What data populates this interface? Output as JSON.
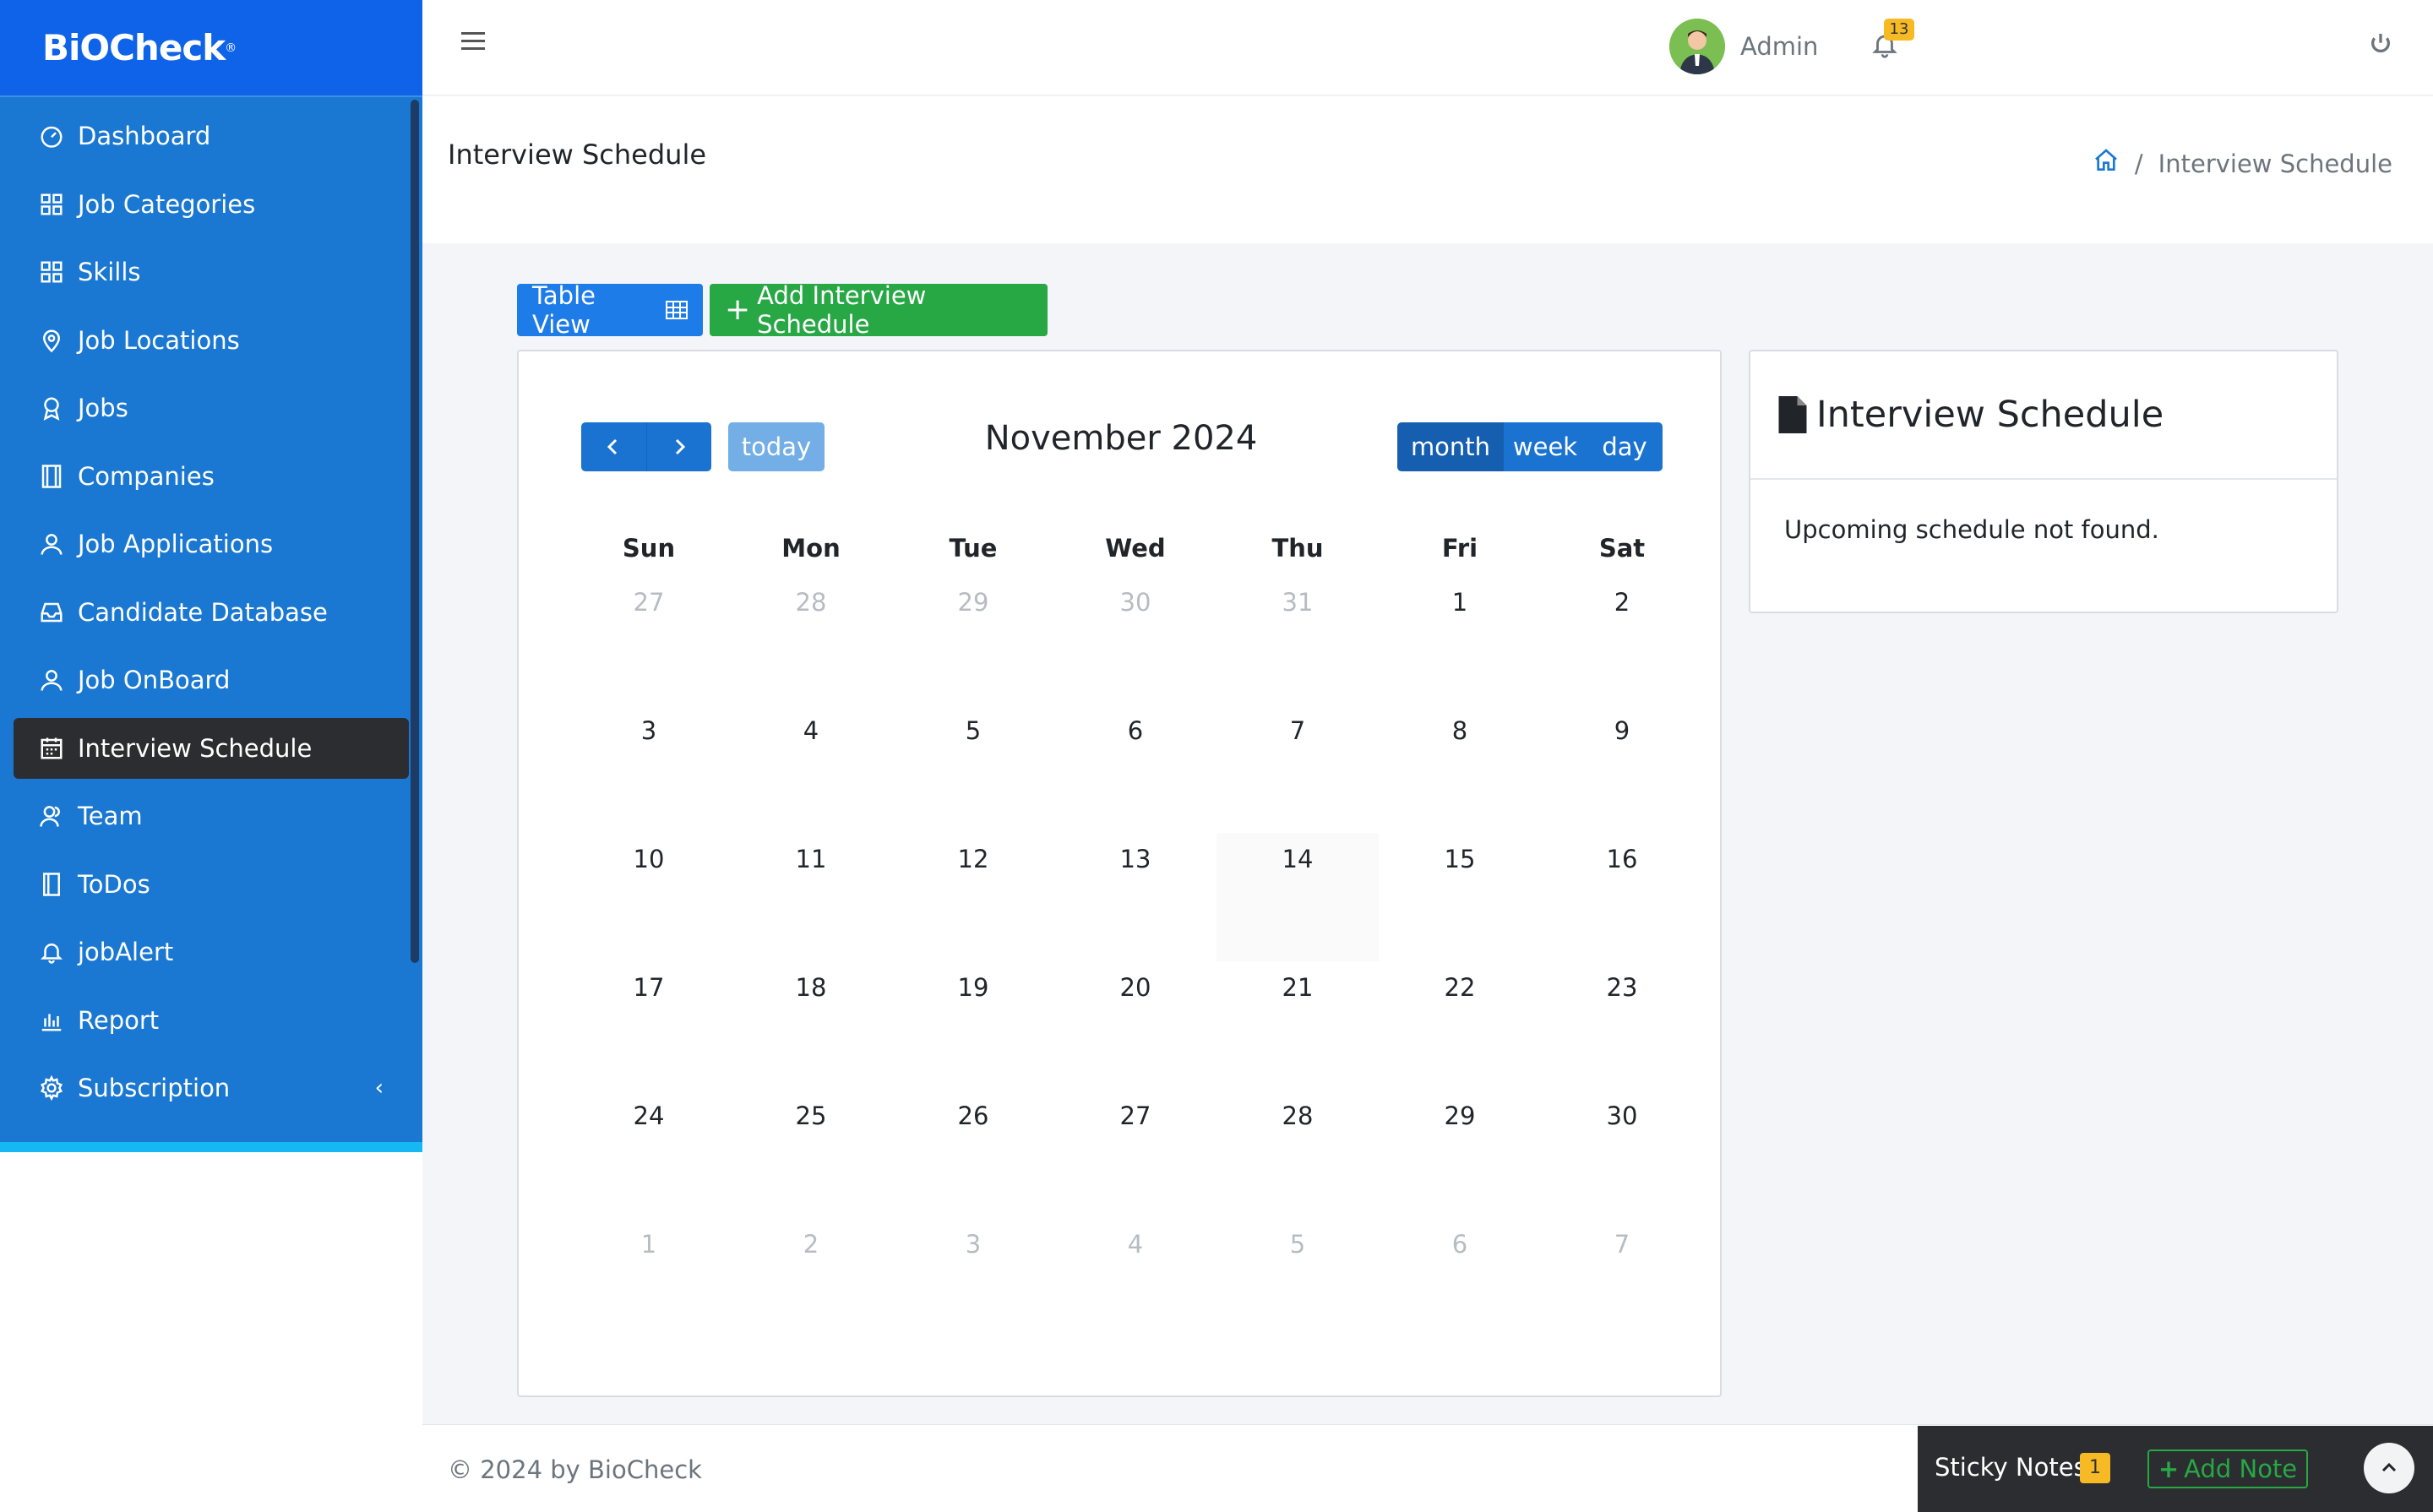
{
  "brand": {
    "name": "BiOCheck",
    "reg": "®"
  },
  "sidebar": {
    "items": [
      {
        "label": "Dashboard",
        "icon": "gauge-icon"
      },
      {
        "label": "Job Categories",
        "icon": "grid-icon"
      },
      {
        "label": "Skills",
        "icon": "grid-icon"
      },
      {
        "label": "Job Locations",
        "icon": "map-pin-icon"
      },
      {
        "label": "Jobs",
        "icon": "award-icon"
      },
      {
        "label": "Companies",
        "icon": "film-icon"
      },
      {
        "label": "Job Applications",
        "icon": "user-icon"
      },
      {
        "label": "Candidate Database",
        "icon": "inbox-icon"
      },
      {
        "label": "Job OnBoard",
        "icon": "user-icon"
      },
      {
        "label": "Interview Schedule",
        "icon": "calendar-icon",
        "active": true
      },
      {
        "label": "Team",
        "icon": "users-icon"
      },
      {
        "label": "ToDos",
        "icon": "notebook-icon"
      },
      {
        "label": "jobAlert",
        "icon": "bell-icon"
      },
      {
        "label": "Report",
        "icon": "bar-chart-icon"
      },
      {
        "label": "Subscription",
        "icon": "gear-icon",
        "chevron": "‹"
      }
    ]
  },
  "header": {
    "user": "Admin",
    "notification_count": "13"
  },
  "page": {
    "title": "Interview Schedule",
    "breadcrumb": {
      "separator": "/",
      "current": "Interview Schedule"
    }
  },
  "actions": {
    "table_view": "Table View",
    "add_schedule": "Add Interview Schedule"
  },
  "calendar": {
    "title": "November 2024",
    "today_label": "today",
    "views": [
      "month",
      "week",
      "day"
    ],
    "weekdays": [
      "Sun",
      "Mon",
      "Tue",
      "Wed",
      "Thu",
      "Fri",
      "Sat"
    ],
    "weeks": [
      [
        {
          "d": "27",
          "o": true
        },
        {
          "d": "28",
          "o": true
        },
        {
          "d": "29",
          "o": true
        },
        {
          "d": "30",
          "o": true
        },
        {
          "d": "31",
          "o": true
        },
        {
          "d": "1"
        },
        {
          "d": "2"
        }
      ],
      [
        {
          "d": "3"
        },
        {
          "d": "4"
        },
        {
          "d": "5"
        },
        {
          "d": "6"
        },
        {
          "d": "7"
        },
        {
          "d": "8"
        },
        {
          "d": "9"
        }
      ],
      [
        {
          "d": "10"
        },
        {
          "d": "11"
        },
        {
          "d": "12"
        },
        {
          "d": "13"
        },
        {
          "d": "14",
          "today": true
        },
        {
          "d": "15"
        },
        {
          "d": "16"
        }
      ],
      [
        {
          "d": "17"
        },
        {
          "d": "18"
        },
        {
          "d": "19"
        },
        {
          "d": "20"
        },
        {
          "d": "21"
        },
        {
          "d": "22"
        },
        {
          "d": "23"
        }
      ],
      [
        {
          "d": "24"
        },
        {
          "d": "25"
        },
        {
          "d": "26"
        },
        {
          "d": "27"
        },
        {
          "d": "28"
        },
        {
          "d": "29"
        },
        {
          "d": "30"
        }
      ],
      [
        {
          "d": "1",
          "o": true
        },
        {
          "d": "2",
          "o": true
        },
        {
          "d": "3",
          "o": true
        },
        {
          "d": "4",
          "o": true
        },
        {
          "d": "5",
          "o": true
        },
        {
          "d": "6",
          "o": true
        },
        {
          "d": "7",
          "o": true
        }
      ]
    ]
  },
  "panel": {
    "title": "Interview Schedule",
    "empty_message": "Upcoming schedule not found."
  },
  "footer": {
    "copyright": "© 2024 by BioCheck"
  },
  "sticky_notes": {
    "label": "Sticky Notes",
    "count": "1",
    "add_label": "Add Note"
  },
  "colors": {
    "sidebar": "#1a78d2",
    "brand_bar": "#0f63e8",
    "active_item": "#2b2d30",
    "primary_button": "#1e7ce8",
    "success_button": "#28a745",
    "badge": "#f7b924"
  }
}
